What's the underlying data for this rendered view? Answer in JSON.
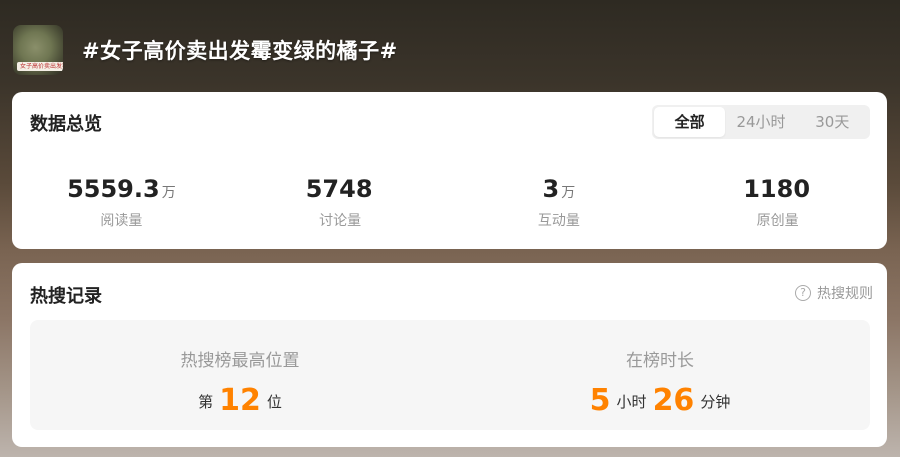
{
  "header": {
    "thumbnail_tag": "女子高价卖出发霉",
    "title": "#女子高价卖出发霉变绿的橘子#"
  },
  "overview": {
    "title": "数据总览",
    "tabs": [
      {
        "label": "全部",
        "active": true
      },
      {
        "label": "24小时",
        "active": false
      },
      {
        "label": "30天",
        "active": false
      }
    ],
    "stats": [
      {
        "value": "5559.3",
        "unit": "万",
        "label": "阅读量"
      },
      {
        "value": "5748",
        "unit": "",
        "label": "讨论量"
      },
      {
        "value": "3",
        "unit": "万",
        "label": "互动量"
      },
      {
        "value": "1180",
        "unit": "",
        "label": "原创量"
      }
    ]
  },
  "hot_search": {
    "title": "热搜记录",
    "rules_link": "热搜规则",
    "rules_icon": "question-circle-icon",
    "highest_rank": {
      "label": "热搜榜最高位置",
      "prefix": "第",
      "value": "12",
      "suffix": "位"
    },
    "duration": {
      "label": "在榜时长",
      "hours": "5",
      "hours_unit": "小时",
      "minutes": "26",
      "minutes_unit": "分钟"
    }
  },
  "colors": {
    "accent": "#ff8200",
    "card_bg": "#ffffff",
    "panel_bg": "#f6f6f6"
  }
}
